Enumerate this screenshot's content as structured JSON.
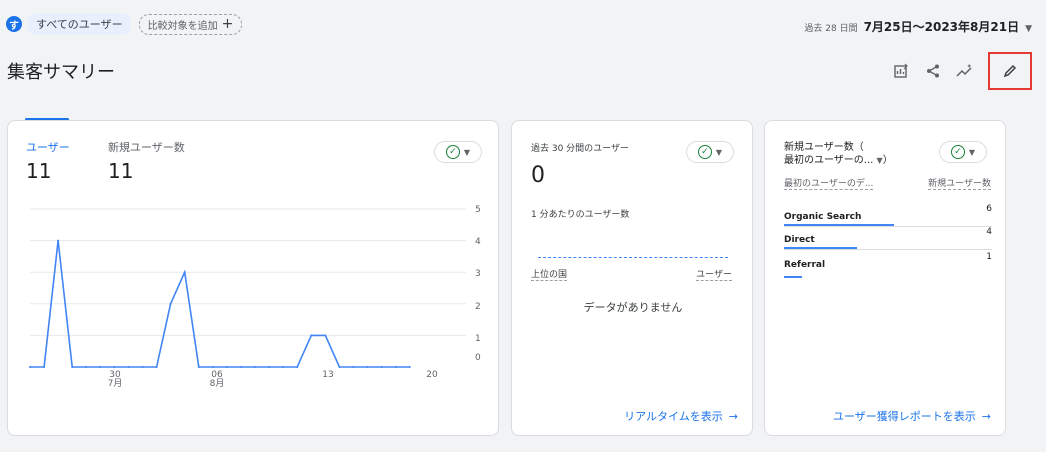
{
  "segment": {
    "avatar": "す",
    "label": "すべてのユーザー",
    "add_compare": "比較対象を追加",
    "add_icon": "+"
  },
  "date_range": {
    "prefix": "過去 28 日間",
    "value": "7月25日～2023年8月21日"
  },
  "page_title": "集客サマリー",
  "toolbar": {
    "icons": [
      "customize-report-icon",
      "share-icon",
      "insights-icon",
      "edit-icon"
    ]
  },
  "users_card": {
    "tabs": [
      {
        "label": "ユーザー",
        "value": "11"
      },
      {
        "label": "新規ユーザー数",
        "value": "11"
      }
    ],
    "y_ticks": [
      "5",
      "4",
      "3",
      "2",
      "1",
      "0"
    ],
    "x_ticks": [
      {
        "top": "30",
        "bottom": "7月"
      },
      {
        "top": "06",
        "bottom": "8月"
      },
      {
        "top": "13",
        "bottom": ""
      },
      {
        "top": "20",
        "bottom": ""
      }
    ]
  },
  "chart_data": {
    "type": "line",
    "x": [
      "7/25",
      "7/26",
      "7/27",
      "7/28",
      "7/29",
      "7/30",
      "7/31",
      "8/1",
      "8/2",
      "8/3",
      "8/4",
      "8/5",
      "8/6",
      "8/7",
      "8/8",
      "8/9",
      "8/10",
      "8/11",
      "8/12",
      "8/13",
      "8/14",
      "8/15",
      "8/16",
      "8/17",
      "8/18",
      "8/19",
      "8/20",
      "8/21"
    ],
    "series": [
      {
        "values": [
          0,
          0,
          4,
          0,
          0,
          0,
          0,
          0,
          0,
          0,
          2,
          3,
          0,
          0,
          0,
          0,
          0,
          0,
          0,
          0,
          1,
          1,
          0,
          0,
          0,
          0,
          0,
          0
        ]
      }
    ],
    "ylim": [
      0,
      5
    ],
    "color": "#4285f4"
  },
  "realtime_card": {
    "title": "過去 30 分間のユーザー",
    "value": "0",
    "per_minute": "1 分あたりのユーザー数",
    "col_country": "上位の国",
    "col_users": "ユーザー",
    "no_data": "データがありません",
    "link": "リアルタイムを表示"
  },
  "acq_card": {
    "title_line1": "新規ユーザー数（",
    "title_line2": "最初のユーザーの...",
    "col_left": "最初のユーザーのデ...",
    "col_right": "新規ユーザー数",
    "rows": [
      {
        "label": "Organic Search",
        "value": "6",
        "share": 1.0
      },
      {
        "label": "Direct",
        "value": "4",
        "share": 0.667
      },
      {
        "label": "Referral",
        "value": "1",
        "share": 0.167
      }
    ],
    "link": "ユーザー獲得レポートを表示"
  },
  "arrow": "→",
  "colors": {
    "accent": "#1a73e8",
    "highlight": "#e53935"
  }
}
